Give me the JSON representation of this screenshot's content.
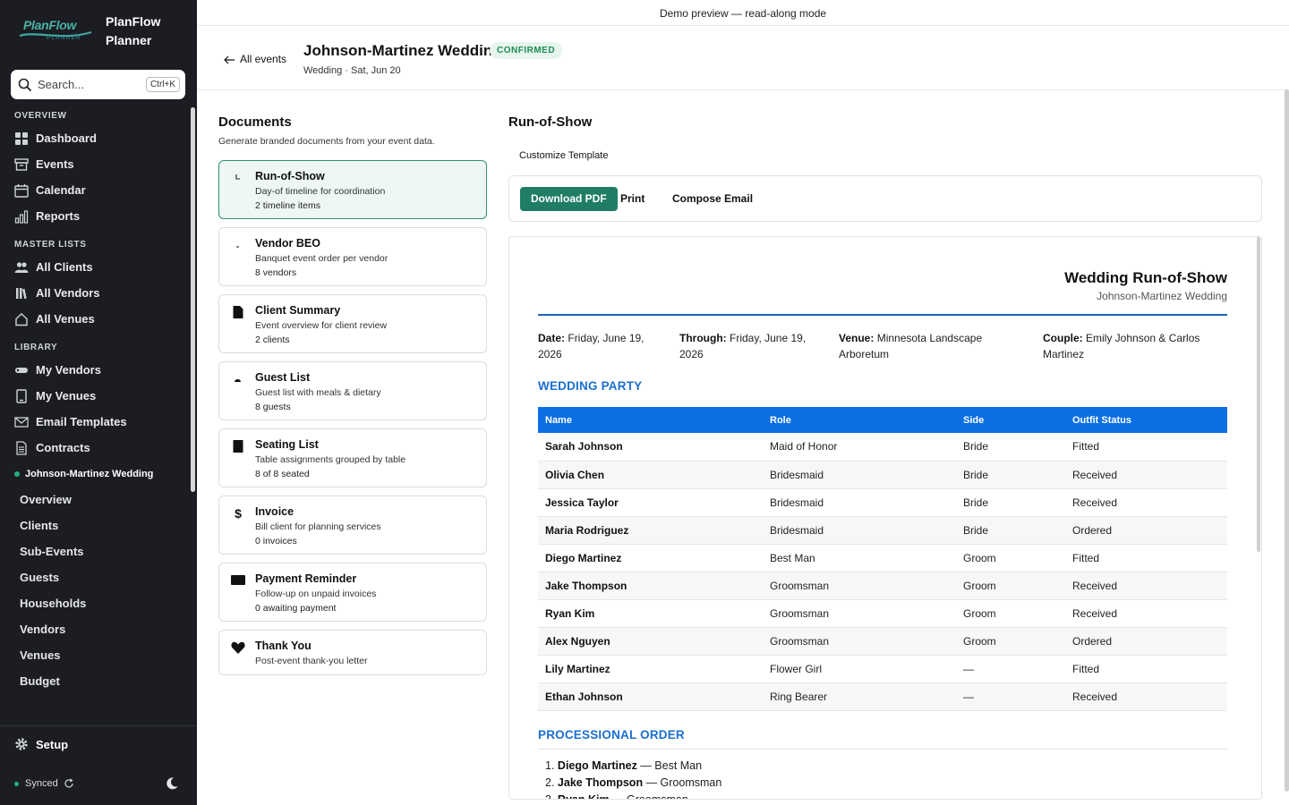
{
  "app": {
    "name_line1": "PlanFlow",
    "name_line2": "Planner",
    "logo_text": "PlanFlow",
    "logo_sub": "PLANNER"
  },
  "search": {
    "placeholder": "Search...",
    "shortcut": "Ctrl+K"
  },
  "sidebar": {
    "overview_title": "OVERVIEW",
    "overview": [
      {
        "label": "Dashboard",
        "icon": "grid-icon"
      },
      {
        "label": "Events",
        "icon": "archive-icon"
      },
      {
        "label": "Calendar",
        "icon": "calendar-icon"
      },
      {
        "label": "Reports",
        "icon": "bar-chart-icon"
      }
    ],
    "master_title": "MASTER LISTS",
    "master": [
      {
        "label": "All Clients",
        "icon": "users-icon"
      },
      {
        "label": "All Vendors",
        "icon": "books-icon"
      },
      {
        "label": "All Venues",
        "icon": "home-icon"
      }
    ],
    "library_title": "LIBRARY",
    "library": [
      {
        "label": "My Vendors",
        "icon": "tag-icon"
      },
      {
        "label": "My Venues",
        "icon": "bookmark-icon"
      },
      {
        "label": "Email Templates",
        "icon": "mail-icon"
      },
      {
        "label": "Contracts",
        "icon": "file-text-icon"
      }
    ],
    "event_name": "Johnson-Martinez Wedding",
    "event_items": [
      "Overview",
      "Clients",
      "Sub-Events",
      "Guests",
      "Households",
      "Vendors",
      "Venues",
      "Budget"
    ],
    "setup": "Setup",
    "synced": "Synced"
  },
  "demo_banner": "Demo preview — read-along mode",
  "header": {
    "back": "All events",
    "title": "Johnson-Martinez Wedding",
    "badge": "CONFIRMED",
    "subtitle": "Wedding · Sat, Jun 20"
  },
  "documents": {
    "title": "Documents",
    "subtitle": "Generate branded documents from your event data.",
    "cards": [
      {
        "title": "Run-of-Show",
        "desc": "Day-of timeline for coordination",
        "count": "2 timeline items",
        "icon": "clock-icon"
      },
      {
        "title": "Vendor BEO",
        "desc": "Banquet event order per vendor",
        "count": "8 vendors",
        "icon": "clipboard-icon"
      },
      {
        "title": "Client Summary",
        "desc": "Event overview for client review",
        "count": "2 clients",
        "icon": "document-icon"
      },
      {
        "title": "Guest List",
        "desc": "Guest list with meals & dietary",
        "count": "8 guests",
        "icon": "guests-icon"
      },
      {
        "title": "Seating List",
        "desc": "Table assignments grouped by table",
        "count": "8 of 8 seated",
        "icon": "chair-icon"
      },
      {
        "title": "Invoice",
        "desc": "Bill client for planning services",
        "count": "0 invoices",
        "icon": "dollar-icon"
      },
      {
        "title": "Payment Reminder",
        "desc": "Follow-up on unpaid invoices",
        "count": "0 awaiting payment",
        "icon": "card-icon"
      },
      {
        "title": "Thank You",
        "desc": "Post-event thank-you letter",
        "count": "",
        "icon": "heart-icon"
      }
    ]
  },
  "run_of_show": {
    "title": "Run-of-Show",
    "customize": "Customize Template",
    "download": "Download PDF",
    "print": "Print",
    "compose": "Compose Email"
  },
  "preview": {
    "heading": "Wedding Run-of-Show",
    "subheading": "Johnson-Martinez Wedding",
    "meta": [
      {
        "label": "Date:",
        "value": "Friday, June 19,",
        "value2": "2026"
      },
      {
        "label": "Through:",
        "value": "Friday, June 19,",
        "value2": "2026"
      },
      {
        "label": "Venue:",
        "value": "Minnesota Landscape",
        "value2": "Arboretum"
      },
      {
        "label": "Couple:",
        "value": "Emily Johnson & Carlos",
        "value2": "Martinez"
      }
    ],
    "party_title": "WEDDING PARTY",
    "party_headers": [
      "Name",
      "Role",
      "Side",
      "Outfit Status"
    ],
    "party_rows": [
      [
        "Sarah Johnson",
        "Maid of Honor",
        "Bride",
        "Fitted"
      ],
      [
        "Olivia Chen",
        "Bridesmaid",
        "Bride",
        "Received"
      ],
      [
        "Jessica Taylor",
        "Bridesmaid",
        "Bride",
        "Received"
      ],
      [
        "Maria Rodriguez",
        "Bridesmaid",
        "Bride",
        "Ordered"
      ],
      [
        "Diego Martinez",
        "Best Man",
        "Groom",
        "Fitted"
      ],
      [
        "Jake Thompson",
        "Groomsman",
        "Groom",
        "Received"
      ],
      [
        "Ryan Kim",
        "Groomsman",
        "Groom",
        "Received"
      ],
      [
        "Alex Nguyen",
        "Groomsman",
        "Groom",
        "Ordered"
      ],
      [
        "Lily Martinez",
        "Flower Girl",
        "—",
        "Fitted"
      ],
      [
        "Ethan Johnson",
        "Ring Bearer",
        "—",
        "Received"
      ]
    ],
    "processional_title": "PROCESSIONAL ORDER",
    "processional": [
      {
        "num": "1.",
        "name": "Diego Martinez",
        "role": " — Best Man"
      },
      {
        "num": "2.",
        "name": "Jake Thompson",
        "role": " — Groomsman"
      },
      {
        "num": "3.",
        "name": "Ryan Kim",
        "role": " — Groomsman"
      }
    ]
  }
}
